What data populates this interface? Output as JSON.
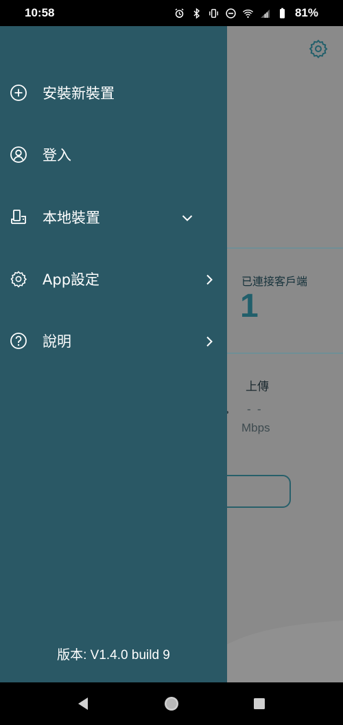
{
  "status_bar": {
    "time": "10:58",
    "battery": "81%"
  },
  "drawer": {
    "items": [
      {
        "label": "安裝新裝置",
        "icon": "add-circle-icon"
      },
      {
        "label": "登入",
        "icon": "user-circle-icon"
      },
      {
        "label": "本地裝置",
        "icon": "devices-icon",
        "chevron": "chevron-down-icon"
      },
      {
        "label": "App設定",
        "icon": "gear-icon",
        "chevron": "chevron-right-icon"
      },
      {
        "label": "說明",
        "icon": "help-icon",
        "chevron": "chevron-right-icon"
      }
    ],
    "version": "版本: V1.4.0 build 9"
  },
  "background": {
    "clients_label": "已連接客戶端",
    "clients_count": "1",
    "upload_label": "上傳",
    "upload_value": "- -",
    "upload_unit": "Mbps"
  },
  "colors": {
    "drawer": "#2a5865",
    "accent": "#215f6b",
    "scrim": "#8a8a8a"
  }
}
